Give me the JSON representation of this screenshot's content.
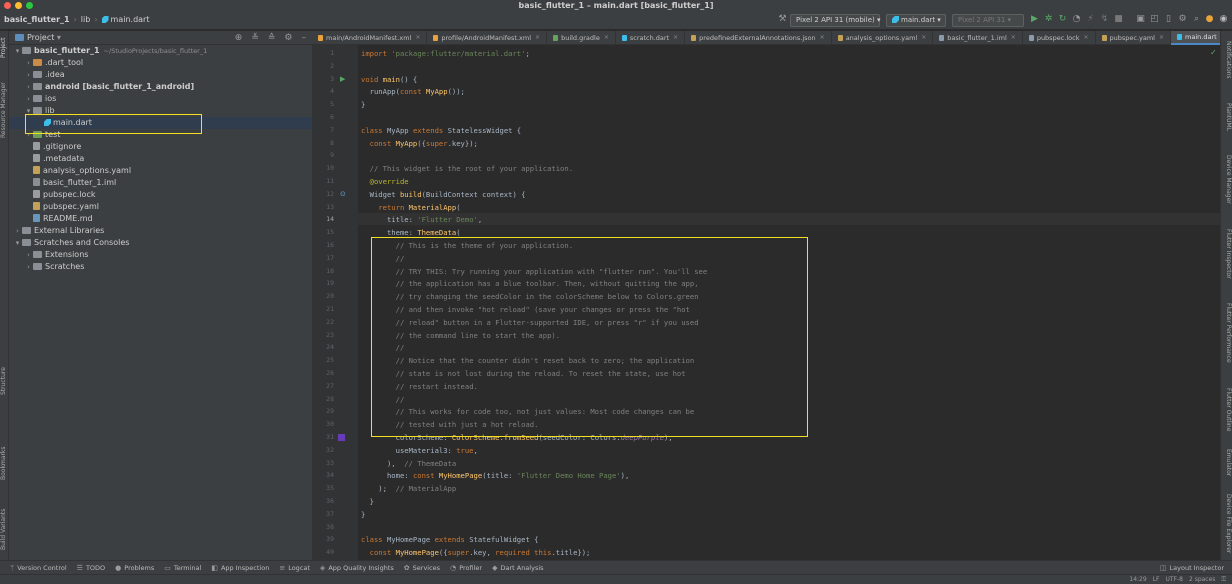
{
  "window": {
    "title": "basic_flutter_1 – main.dart [basic_flutter_1]",
    "traffic_colors": [
      "#ff5f57",
      "#febc2e",
      "#28c840"
    ]
  },
  "toolbar": {
    "breadcrumb": [
      "basic_flutter_1",
      "lib",
      "main.dart"
    ],
    "device_combo": "Pixel 2 API 31 (mobile)",
    "config_combo": "main.dart",
    "device_combo_2": "Pixel 2 API 31"
  },
  "project_panel": {
    "title": "Project",
    "tree": [
      {
        "label": "basic_flutter_1",
        "extra": "~/StudioProjects/basic_flutter_1",
        "indent": 0,
        "chev": "▾",
        "icon": "folder",
        "bold": true
      },
      {
        "label": ".dart_tool",
        "indent": 1,
        "chev": "›",
        "icon": "folder-orange"
      },
      {
        "label": ".idea",
        "indent": 1,
        "chev": "›",
        "icon": "folder"
      },
      {
        "label": "android [basic_flutter_1_android]",
        "indent": 1,
        "chev": "›",
        "icon": "folder",
        "bold": true
      },
      {
        "label": "ios",
        "indent": 1,
        "chev": "›",
        "icon": "folder"
      },
      {
        "label": "lib",
        "indent": 1,
        "chev": "▾",
        "icon": "folder"
      },
      {
        "label": "main.dart",
        "indent": 2,
        "chev": "",
        "icon": "dart"
      },
      {
        "label": "test",
        "indent": 1,
        "chev": "›",
        "icon": "folder-green"
      },
      {
        "label": ".gitignore",
        "indent": 1,
        "chev": "",
        "icon": "file"
      },
      {
        "label": ".metadata",
        "indent": 1,
        "chev": "",
        "icon": "file"
      },
      {
        "label": "analysis_options.yaml",
        "indent": 1,
        "chev": "",
        "icon": "yaml"
      },
      {
        "label": "basic_flutter_1.iml",
        "indent": 1,
        "chev": "",
        "icon": "iml"
      },
      {
        "label": "pubspec.lock",
        "indent": 1,
        "chev": "",
        "icon": "lock"
      },
      {
        "label": "pubspec.yaml",
        "indent": 1,
        "chev": "",
        "icon": "yaml"
      },
      {
        "label": "README.md",
        "indent": 1,
        "chev": "",
        "icon": "md"
      },
      {
        "label": "External Libraries",
        "indent": 0,
        "chev": "›",
        "icon": "folder"
      },
      {
        "label": "Scratches and Consoles",
        "indent": 0,
        "chev": "▾",
        "icon": "folder"
      },
      {
        "label": "Extensions",
        "indent": 1,
        "chev": "›",
        "icon": "folder"
      },
      {
        "label": "Scratches",
        "indent": 1,
        "chev": "›",
        "icon": "folder"
      }
    ]
  },
  "left_stripe": [
    "Project",
    "Resource Manager",
    "Structure",
    "Bookmarks",
    "Build Variants"
  ],
  "right_stripe": [
    "Notifications",
    "PlantUML",
    "Device Manager",
    "Flutter Inspector",
    "Flutter Performance",
    "Flutter Outline",
    "Emulator",
    "Device File Explorer"
  ],
  "tabs": [
    {
      "label": "main/AndroidManifest.xml",
      "type": "xml"
    },
    {
      "label": "profile/AndroidManifest.xml",
      "type": "xml"
    },
    {
      "label": "build.gradle",
      "type": "gradle"
    },
    {
      "label": "scratch.dart",
      "type": "dart"
    },
    {
      "label": "predefinedExternalAnnotations.json",
      "type": "json"
    },
    {
      "label": "analysis_options.yaml",
      "type": "json"
    },
    {
      "label": "basic_flutter_1.iml",
      "type": "file"
    },
    {
      "label": "pubspec.lock",
      "type": "file"
    },
    {
      "label": "pubspec.yaml",
      "type": "json"
    },
    {
      "label": "main.dart",
      "type": "dart",
      "active": true
    }
  ],
  "editor": {
    "current_line": 14,
    "lines": [
      {
        "n": 1,
        "html": "<span class='k'>import </span><span class='s'>'package:flutter/material.dart'</span>;"
      },
      {
        "n": 2,
        "html": ""
      },
      {
        "n": 3,
        "html": "<span class='k'>void </span><span class='f'>main</span>() {"
      },
      {
        "n": 4,
        "html": "  runApp(<span class='k'>const </span><span class='f'>MyApp</span>());"
      },
      {
        "n": 5,
        "html": "}"
      },
      {
        "n": 6,
        "html": ""
      },
      {
        "n": 7,
        "html": "<span class='k'>class </span>MyApp <span class='k'>extends </span>StatelessWidget {"
      },
      {
        "n": 8,
        "html": "  <span class='k'>const </span><span class='f'>MyApp</span>({<span class='k'>super</span>.key});"
      },
      {
        "n": 9,
        "html": ""
      },
      {
        "n": 10,
        "html": "  <span class='c'>// This widget is the root of your application.</span>"
      },
      {
        "n": 11,
        "html": "  <span class='a'>@override</span>"
      },
      {
        "n": 12,
        "html": "  Widget <span class='f'>build</span>(BuildContext context) {"
      },
      {
        "n": 13,
        "html": "    <span class='k'>return </span><span class='f'>MaterialApp</span>("
      },
      {
        "n": 14,
        "html": "      title: <span class='s'>'Flutter Demo'</span>,"
      },
      {
        "n": 15,
        "html": "      theme: <span class='f'>ThemeData</span>("
      },
      {
        "n": 16,
        "html": "        <span class='c'>// This is the theme of your application.</span>"
      },
      {
        "n": 17,
        "html": "        <span class='c'>//</span>"
      },
      {
        "n": 18,
        "html": "        <span class='c'>// TRY THIS: Try running your application with \"flutter run\". You'll see</span>"
      },
      {
        "n": 19,
        "html": "        <span class='c'>// the application has a blue toolbar. Then, without quitting the app,</span>"
      },
      {
        "n": 20,
        "html": "        <span class='c'>// try changing the seedColor in the colorScheme below to Colors.green</span>"
      },
      {
        "n": 21,
        "html": "        <span class='c'>// and then invoke \"hot reload\" (save your changes or press the \"hot</span>"
      },
      {
        "n": 22,
        "html": "        <span class='c'>// reload\" button in a Flutter-supported IDE, or press \"r\" if you used</span>"
      },
      {
        "n": 23,
        "html": "        <span class='c'>// the command line to start the app).</span>"
      },
      {
        "n": 24,
        "html": "        <span class='c'>//</span>"
      },
      {
        "n": 25,
        "html": "        <span class='c'>// Notice that the counter didn't reset back to zero; the application</span>"
      },
      {
        "n": 26,
        "html": "        <span class='c'>// state is not lost during the reload. To reset the state, use hot</span>"
      },
      {
        "n": 27,
        "html": "        <span class='c'>// restart instead.</span>"
      },
      {
        "n": 28,
        "html": "        <span class='c'>//</span>"
      },
      {
        "n": 29,
        "html": "        <span class='c'>// This works for code too, not just values: Most code changes can be</span>"
      },
      {
        "n": 30,
        "html": "        <span class='c'>// tested with just a hot reload.</span>"
      },
      {
        "n": 31,
        "html": "        colorScheme: <span class='f'>ColorScheme</span>.<span class='f'>fromSeed</span>(seedColor: Colors.<span class='p'>deepPurple</span>),"
      },
      {
        "n": 32,
        "html": "        useMaterial3: <span class='k'>true</span>,"
      },
      {
        "n": 33,
        "html": "      ),  <span class='c'>// ThemeData</span>"
      },
      {
        "n": 34,
        "html": "      home: <span class='k'>const </span><span class='f'>MyHomePage</span>(title: <span class='s'>'Flutter Demo Home Page'</span>),"
      },
      {
        "n": 35,
        "html": "    );  <span class='c'>// MaterialApp</span>"
      },
      {
        "n": 36,
        "html": "  }"
      },
      {
        "n": 37,
        "html": "}"
      },
      {
        "n": 38,
        "html": ""
      },
      {
        "n": 39,
        "html": "<span class='k'>class </span>MyHomePage <span class='k'>extends </span>StatefulWidget {"
      },
      {
        "n": 40,
        "html": "  <span class='k'>const </span><span class='f'>MyHomePage</span>({<span class='k'>super</span>.key, <span class='k'>required this</span>.title});"
      }
    ]
  },
  "bottom_tools": [
    {
      "label": "Version Control",
      "icon": "branch-icon",
      "glyph": "ᛘ"
    },
    {
      "label": "TODO",
      "icon": "list-icon",
      "glyph": "☰"
    },
    {
      "label": "Problems",
      "icon": "problems-icon",
      "glyph": "●"
    },
    {
      "label": "Terminal",
      "icon": "terminal-icon",
      "glyph": "▭"
    },
    {
      "label": "App Inspection",
      "icon": "inspection-icon",
      "glyph": "◧"
    },
    {
      "label": "Logcat",
      "icon": "logcat-icon",
      "glyph": "≡"
    },
    {
      "label": "App Quality Insights",
      "icon": "insights-icon",
      "glyph": "◈"
    },
    {
      "label": "Services",
      "icon": "services-icon",
      "glyph": "✿"
    },
    {
      "label": "Profiler",
      "icon": "profiler-icon",
      "glyph": "◔"
    },
    {
      "label": "Dart Analysis",
      "icon": "dart-analysis-icon",
      "glyph": "◆"
    }
  ],
  "layout_inspector": "Layout Inspector",
  "status": {
    "position": "14:29",
    "line_sep": "LF",
    "encoding": "UTF-8",
    "indent": "2 spaces"
  },
  "highlight_color": "#f0e021"
}
